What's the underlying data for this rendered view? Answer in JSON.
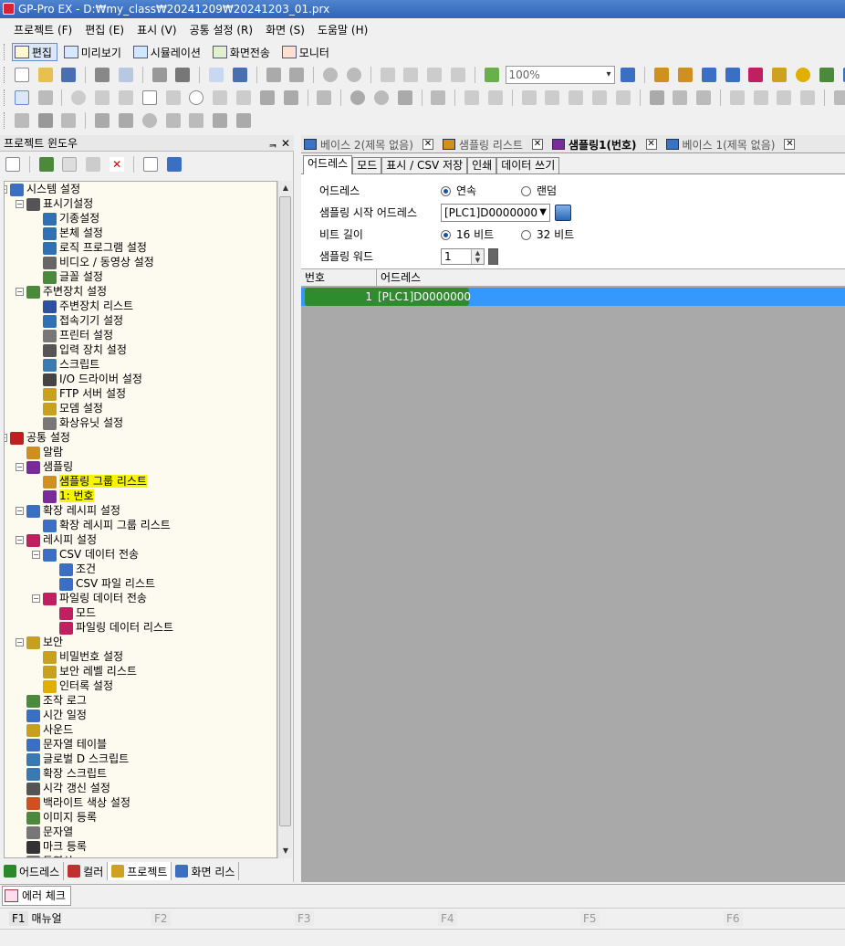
{
  "window": {
    "title": "GP-Pro EX - D:₩my_class₩20241209₩20241203_01.prx"
  },
  "menu": [
    "프로젝트 (F)",
    "편집 (E)",
    "표시 (V)",
    "공통 설정 (R)",
    "화면 (S)",
    "도움말 (H)"
  ],
  "mode_toolbar": [
    {
      "label": "편집",
      "icon": "edit-icon",
      "active": true
    },
    {
      "label": "미리보기",
      "icon": "preview-icon",
      "active": false
    },
    {
      "label": "시뮬레이션",
      "icon": "simulation-icon",
      "active": false
    },
    {
      "label": "화면전송",
      "icon": "transfer-icon",
      "active": false
    },
    {
      "label": "모니터",
      "icon": "monitor-icon",
      "active": false
    }
  ],
  "zoom": {
    "value": "100%"
  },
  "project_window": {
    "title": "프로젝트 윈도우",
    "pin": "ᆿ",
    "close": "✕",
    "tree": [
      {
        "label": "시스템 설정",
        "level": 0,
        "expander": "−",
        "color": "#3a6fc4"
      },
      {
        "label": "표시기설정",
        "level": 1,
        "expander": "−",
        "color": "#555"
      },
      {
        "label": "기종설정",
        "level": 2,
        "color": "#2f6fb3"
      },
      {
        "label": "본체 설정",
        "level": 2,
        "color": "#2f6fb3"
      },
      {
        "label": "로직 프로그램 설정",
        "level": 2,
        "color": "#2f6fb3"
      },
      {
        "label": "비디오 / 동영상 설정",
        "level": 2,
        "color": "#666"
      },
      {
        "label": "글꼴 설정",
        "level": 2,
        "color": "#4a8a3a"
      },
      {
        "label": "주변장치 설정",
        "level": 1,
        "expander": "−",
        "color": "#4a8a3a"
      },
      {
        "label": "주변장치 리스트",
        "level": 2,
        "color": "#2f4fa3"
      },
      {
        "label": "접속기기 설정",
        "level": 2,
        "color": "#2f6fb3"
      },
      {
        "label": "프린터 설정",
        "level": 2,
        "color": "#777"
      },
      {
        "label": "입력 장치 설정",
        "level": 2,
        "color": "#555"
      },
      {
        "label": "스크립트",
        "level": 2,
        "color": "#3a7ab3"
      },
      {
        "label": "I/O 드라이버 설정",
        "level": 2,
        "color": "#444"
      },
      {
        "label": "FTP 서버 설정",
        "level": 2,
        "color": "#c8a020"
      },
      {
        "label": "모뎀 설정",
        "level": 2,
        "color": "#c8a020"
      },
      {
        "label": "화상유닛 설정",
        "level": 2,
        "color": "#777"
      },
      {
        "label": "공통 설정",
        "level": 0,
        "expander": "−",
        "color": "#c02020"
      },
      {
        "label": "알람",
        "level": 1,
        "color": "#d09020"
      },
      {
        "label": "샘플링",
        "level": 1,
        "expander": "−",
        "color": "#7a2a9a"
      },
      {
        "label": "샘플링 그룹 리스트",
        "level": 2,
        "color": "#d09020",
        "highlight": true
      },
      {
        "label": "1: 번호",
        "level": 2,
        "color": "#7a2a9a",
        "highlight": true
      },
      {
        "label": "확장 레시피 설정",
        "level": 1,
        "expander": "−",
        "color": "#3a6fc4"
      },
      {
        "label": "확장 레시피 그룹 리스트",
        "level": 2,
        "color": "#3a6fc4"
      },
      {
        "label": "레시피 설정",
        "level": 1,
        "expander": "−",
        "color": "#c02060"
      },
      {
        "label": "CSV 데이터 전송",
        "level": 2,
        "expander": "−",
        "color": "#3a6fc4"
      },
      {
        "label": "조건",
        "level": 3,
        "color": "#3a6fc4"
      },
      {
        "label": "CSV 파일 리스트",
        "level": 3,
        "color": "#3a6fc4"
      },
      {
        "label": "파일링 데이터 전송",
        "level": 2,
        "expander": "−",
        "color": "#c02060"
      },
      {
        "label": "모드",
        "level": 3,
        "color": "#c02060"
      },
      {
        "label": "파일링 데이터 리스트",
        "level": 3,
        "color": "#c02060"
      },
      {
        "label": "보안",
        "level": 1,
        "expander": "−",
        "color": "#c8a020"
      },
      {
        "label": "비밀번호 설정",
        "level": 2,
        "color": "#c8a020"
      },
      {
        "label": "보안 레벨 리스트",
        "level": 2,
        "color": "#c8a020"
      },
      {
        "label": "인터록 설정",
        "level": 2,
        "color": "#e0b000"
      },
      {
        "label": "조작 로그",
        "level": 1,
        "color": "#4a8a3a"
      },
      {
        "label": "시간 일정",
        "level": 1,
        "color": "#3a6fc4"
      },
      {
        "label": "사운드",
        "level": 1,
        "color": "#c8a020"
      },
      {
        "label": "문자열 테이블",
        "level": 1,
        "color": "#3a6fc4"
      },
      {
        "label": "글로벌 D 스크립트",
        "level": 1,
        "color": "#3a7ab3"
      },
      {
        "label": "확장 스크립트",
        "level": 1,
        "color": "#3a7ab3"
      },
      {
        "label": "시각 갱신 설정",
        "level": 1,
        "color": "#555"
      },
      {
        "label": "백라이트 색상 설정",
        "level": 1,
        "color": "#d05020"
      },
      {
        "label": "이미지 등록",
        "level": 1,
        "color": "#4a8a3a"
      },
      {
        "label": "문자열",
        "level": 1,
        "color": "#777"
      },
      {
        "label": "마크 등록",
        "level": 1,
        "color": "#333"
      },
      {
        "label": "동영상",
        "level": 1,
        "color": "#777"
      }
    ],
    "bottom_tabs": [
      {
        "label": "어드레스",
        "color": "#2a8a2a",
        "active": false
      },
      {
        "label": "컬러",
        "color": "#c03030",
        "active": false
      },
      {
        "label": "프로젝트",
        "color": "#d0a020",
        "active": true
      },
      {
        "label": "화면 리스",
        "color": "#3a6fc4",
        "active": false
      }
    ]
  },
  "doc_tabs": [
    {
      "label": "베이스 2(제목 없음)",
      "active": false
    },
    {
      "label": "샘플링 리스트",
      "active": false
    },
    {
      "label": "샘플링1(번호)",
      "active": true
    },
    {
      "label": "베이스 1(제목 없음)",
      "active": false
    }
  ],
  "panel_tabs": [
    "어드레스",
    "모드",
    "표시 / CSV 저장",
    "인쇄",
    "데이터 쓰기"
  ],
  "form": {
    "address_label": "어드레스",
    "address_opt1": "연속",
    "address_opt2": "랜덤",
    "start_label": "샘플링 시작 어드레스",
    "start_value": "[PLC1]D0000000",
    "bit_label": "비트 길이",
    "bit_opt1": "16 비트",
    "bit_opt2": "32 비트",
    "words_label": "샘플링 워드",
    "words_value": "1"
  },
  "grid": {
    "columns": [
      "번호",
      "어드레스"
    ],
    "rows": [
      {
        "no": "1",
        "address": "[PLC1]D0000000"
      }
    ]
  },
  "error_tab": {
    "label": "에러 체크"
  },
  "fkeys": [
    {
      "key": "F1",
      "label": "매뉴얼",
      "enabled": true
    },
    {
      "key": "F2",
      "label": "",
      "enabled": false
    },
    {
      "key": "F3",
      "label": "",
      "enabled": false
    },
    {
      "key": "F4",
      "label": "",
      "enabled": false
    },
    {
      "key": "F5",
      "label": "",
      "enabled": false
    },
    {
      "key": "F6",
      "label": "",
      "enabled": false
    }
  ]
}
